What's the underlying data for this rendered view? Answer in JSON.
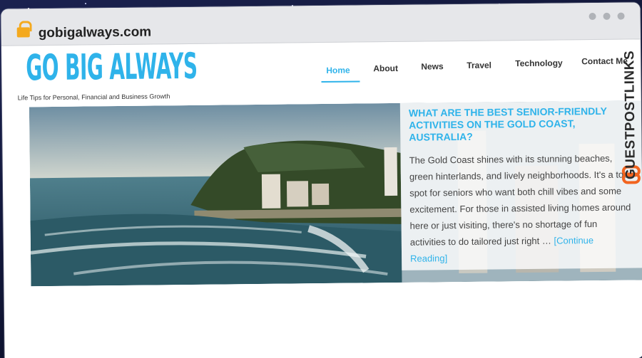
{
  "browser": {
    "url": "gobigalways.com",
    "icons": [
      "lock-icon",
      "window-dot-icon"
    ]
  },
  "site": {
    "logo_text": "GO BIG ALWAYS",
    "tagline": "Life Tips for Personal, Financial and Business Growth",
    "brand_color": "#2fb3ea"
  },
  "nav": {
    "items": [
      {
        "label": "Home",
        "active": true
      },
      {
        "label": "About"
      },
      {
        "label": "News"
      },
      {
        "label": "Travel"
      },
      {
        "label": "Technology"
      },
      {
        "label": "Contact Me"
      }
    ]
  },
  "featured": {
    "title": "WHAT ARE THE BEST SENIOR-FRIENDLY ACTIVITIES ON THE GOLD COAST, AUSTRALIA?",
    "excerpt": "The Gold Coast shines with its stunning beaches, green hinterlands, and lively neighborhoods. It's a top spot for seniors who want both chill vibes and some excitement. For those in assisted living homes around here or just visiting, there's no shortage of fun activities to do tailored just right … ",
    "read_more": "[Continue Reading]"
  },
  "watermark": {
    "text": "GUESTPOSTLINKS"
  }
}
